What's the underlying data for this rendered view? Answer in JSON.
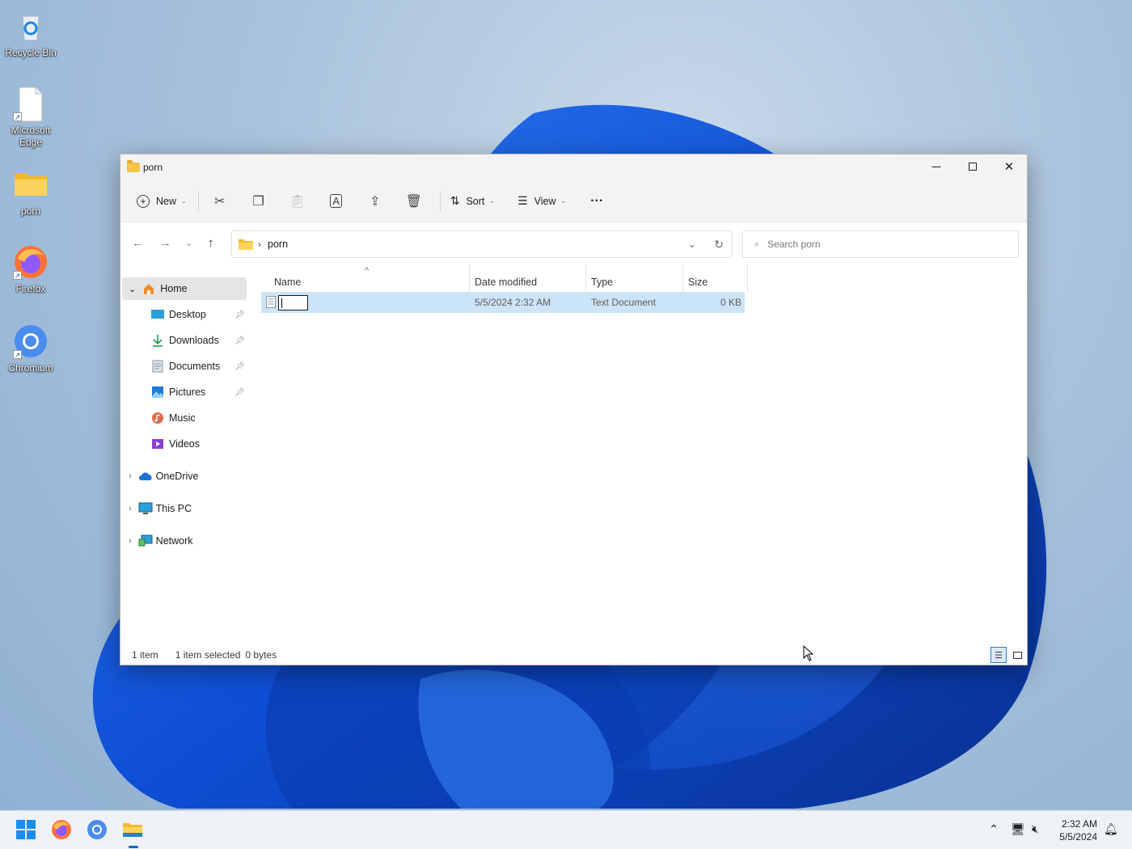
{
  "desktop": {
    "icons": [
      {
        "label": "Recycle Bin",
        "icon": "recycle-bin-icon"
      },
      {
        "label": "Microsoft\nEdge",
        "icon": "edge-file-icon"
      },
      {
        "label": "porn",
        "icon": "folder-icon"
      },
      {
        "label": "Firefox",
        "icon": "firefox-icon"
      },
      {
        "label": "Chromium",
        "icon": "chromium-icon"
      }
    ]
  },
  "window": {
    "title": "porn",
    "toolbar": {
      "new_label": "New",
      "sort_label": "Sort",
      "view_label": "View",
      "more_label": "···"
    },
    "address": {
      "path": "porn",
      "separator": "›"
    },
    "search": {
      "placeholder": "Search porn"
    },
    "sidebar": {
      "home": "Home",
      "quick": [
        {
          "label": "Desktop",
          "pinned": true
        },
        {
          "label": "Downloads",
          "pinned": true
        },
        {
          "label": "Documents",
          "pinned": true
        },
        {
          "label": "Pictures",
          "pinned": true
        },
        {
          "label": "Music",
          "pinned": false
        },
        {
          "label": "Videos",
          "pinned": false
        }
      ],
      "onedrive": "OneDrive",
      "thispc": "This PC",
      "network": "Network"
    },
    "columns": {
      "name": "Name",
      "date": "Date modified",
      "type": "Type",
      "size": "Size"
    },
    "files": [
      {
        "name": "",
        "date": "5/5/2024 2:32 AM",
        "type": "Text Document",
        "size": "0 KB",
        "selected": true,
        "renaming": true
      }
    ],
    "status": {
      "count": "1 item",
      "selection": "1 item selected",
      "bytes": "0 bytes"
    }
  },
  "taskbar": {
    "time": "2:32 AM",
    "date": "5/5/2024"
  },
  "colors": {
    "accent": "#0067c0",
    "selection": "#cce4f7",
    "folder": "#f6c544"
  }
}
